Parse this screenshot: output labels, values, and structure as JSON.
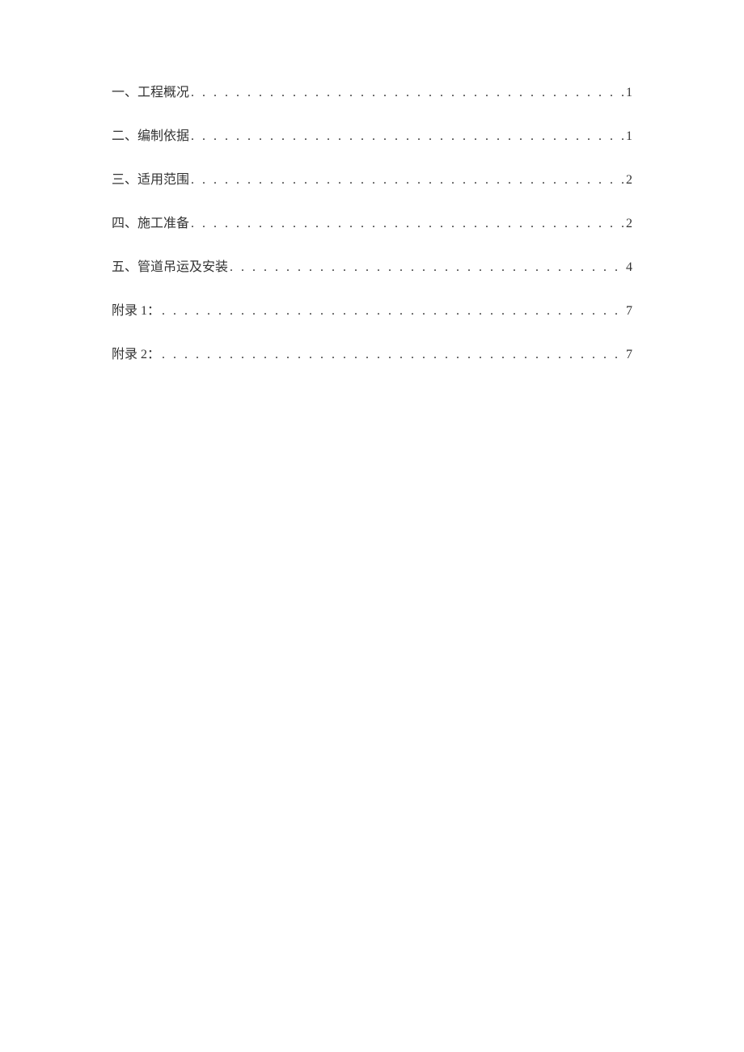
{
  "toc": {
    "entries": [
      {
        "title": "一、工程概况",
        "page": "1"
      },
      {
        "title": "二、编制依据",
        "page": "1"
      },
      {
        "title": "三、适用范围",
        "page": "2"
      },
      {
        "title": "四、施工准备",
        "page": "2"
      },
      {
        "title": "五、管道吊运及安装",
        "page": "4"
      },
      {
        "title": "附录 1：",
        "page": "7"
      },
      {
        "title": "附录 2：",
        "page": "7"
      }
    ]
  }
}
